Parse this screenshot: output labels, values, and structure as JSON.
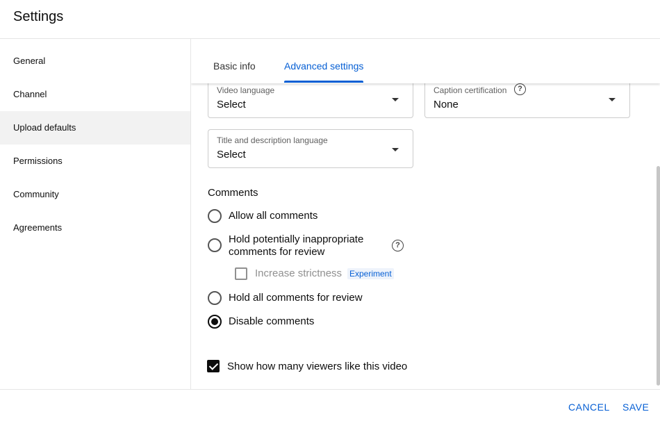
{
  "header": {
    "title": "Settings"
  },
  "sidebar": {
    "items": [
      {
        "label": "General"
      },
      {
        "label": "Channel"
      },
      {
        "label": "Upload defaults",
        "active": true
      },
      {
        "label": "Permissions"
      },
      {
        "label": "Community"
      },
      {
        "label": "Agreements"
      }
    ]
  },
  "tabs": [
    {
      "label": "Basic info"
    },
    {
      "label": "Advanced settings",
      "active": true
    }
  ],
  "fields": {
    "video_language": {
      "label": "Video language",
      "value": "Select"
    },
    "caption_certification": {
      "label": "Caption certification",
      "value": "None"
    },
    "title_description_language": {
      "label": "Title and description language",
      "value": "Select"
    }
  },
  "comments": {
    "title": "Comments",
    "options": [
      {
        "label": "Allow all comments",
        "checked": false
      },
      {
        "label_line1": "Hold potentially inappropriate",
        "label_line2": "comments for review",
        "checked": false
      },
      {
        "label": "Hold all comments for review",
        "checked": false
      },
      {
        "label": "Disable comments",
        "checked": true
      }
    ],
    "strictness": {
      "label": "Increase strictness",
      "badge": "Experiment",
      "checked": false
    }
  },
  "ratings": {
    "label": "Show how many viewers like this video",
    "checked": true
  },
  "footer": {
    "cancel": "CANCEL",
    "save": "SAVE"
  },
  "colors": {
    "accent": "#065fd4",
    "text": "#0d0d0d",
    "active_nav_bg": "#f2f2f2"
  },
  "icons": {
    "help": "help-circle-icon",
    "dropdown": "dropdown-caret-icon"
  }
}
